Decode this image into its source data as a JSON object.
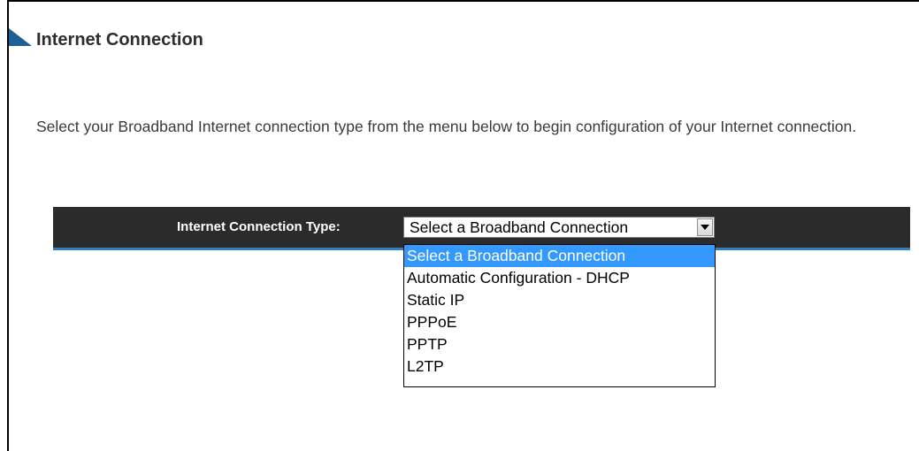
{
  "page": {
    "title": "Internet Connection",
    "description": "Select your Broadband Internet connection type from the menu below to begin configuration of your Internet connection."
  },
  "connection_form": {
    "label": "Internet Connection Type:",
    "selected_value": "Select a Broadband Connection",
    "options": [
      "Select a Broadband Connection",
      "Automatic Configuration - DHCP",
      "Static IP",
      "PPPoE",
      "PPTP",
      "L2TP"
    ],
    "highlighted_index": 0
  },
  "colors": {
    "bar_background": "#2b2b2b",
    "bar_underline": "#2f7fc1",
    "highlight": "#3399ff",
    "title_arrow": "#1f5f96"
  },
  "icons": {
    "title_marker": "triangle-arrow-icon",
    "dropdown_toggle": "chevron-down-icon"
  }
}
